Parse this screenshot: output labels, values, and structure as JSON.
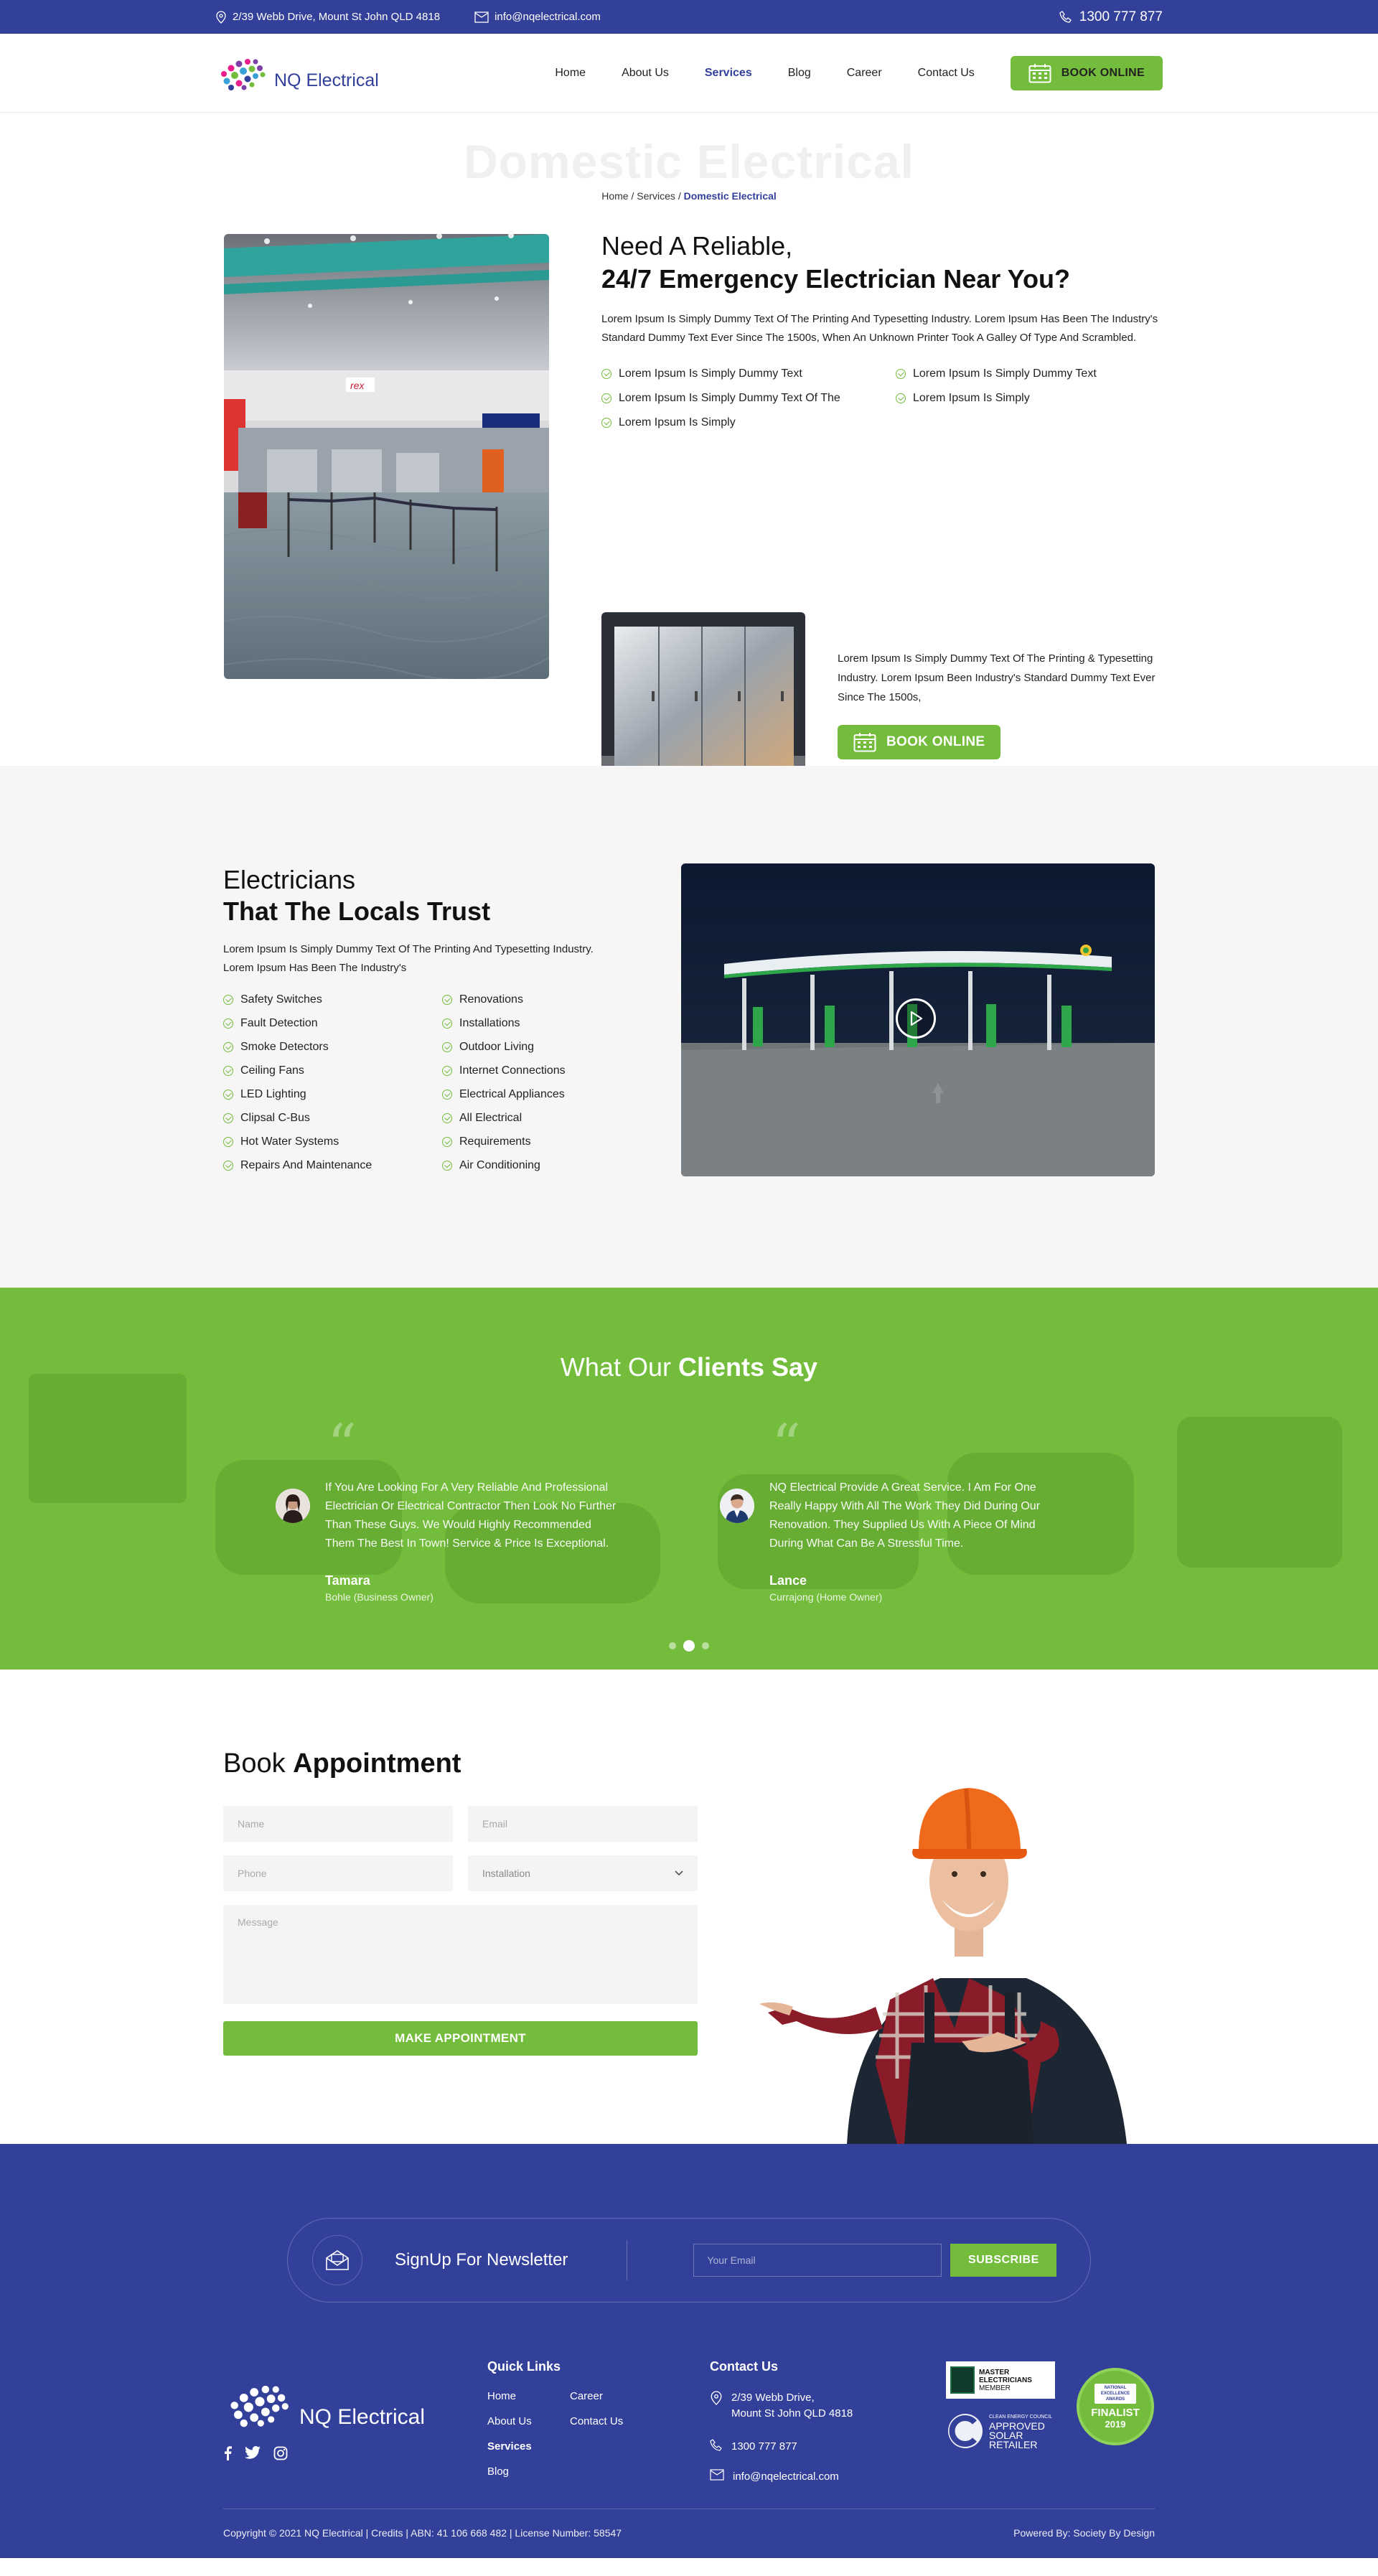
{
  "topbar": {
    "address": "2/39 Webb Drive,  Mount St John QLD 4818",
    "email": "info@nqelectrical.com",
    "phone": "1300 777 877"
  },
  "header": {
    "logo_text": "NQ Electrical",
    "nav": [
      "Home",
      "About Us",
      "Services",
      "Blog",
      "Career",
      "Contact Us"
    ],
    "active_nav": "Services",
    "book_label": "BOOK ONLINE"
  },
  "page_title": {
    "title": "Domestic Electrical",
    "crumb_home": "Home",
    "crumb_sep1": " / ",
    "crumb_services": "Services",
    "crumb_sep2": " / ",
    "crumb_current": "Domestic Electrical"
  },
  "intro": {
    "heading_light": "Need A Reliable,",
    "heading_bold": "24/7 Emergency Electrician Near You?",
    "paragraph": "Lorem Ipsum Is Simply Dummy Text Of The Printing And Typesetting Industry. Lorem Ipsum Has Been The Industry's Standard Dummy Text Ever Since The 1500s, When An Unknown Printer Took A Galley Of Type And Scrambled.",
    "checks": [
      "Lorem Ipsum Is Simply Dummy Text",
      "Lorem Ipsum Is Simply Dummy Text",
      "Lorem Ipsum Is Simply Dummy Text Of The",
      "Lorem Ipsum Is Simply",
      "Lorem Ipsum Is Simply"
    ],
    "paragraph2": "Lorem Ipsum Is Simply Dummy Text Of The Printing & Typesetting Industry. Lorem Ipsum Been Industry's Standard Dummy Text Ever Since The 1500s,",
    "book_label": "BOOK ONLINE"
  },
  "electricians": {
    "heading_light": "Electricians",
    "heading_bold": "That The Locals Trust",
    "paragraph": "Lorem Ipsum Is Simply Dummy Text Of The Printing And Typesetting Industry. Lorem Ipsum Has Been The Industry's",
    "services": [
      "Safety Switches",
      "Renovations",
      "Fault Detection",
      "Installations",
      "Smoke Detectors",
      "Outdoor Living",
      "Ceiling Fans",
      "Internet Connections",
      "LED Lighting",
      "Electrical Appliances",
      "Clipsal C-Bus",
      "All Electrical",
      "Hot Water Systems",
      "Requirements",
      "Repairs And Maintenance",
      "Air Conditioning"
    ]
  },
  "testimonials": {
    "heading_light": "What Our ",
    "heading_bold": "Clients Say",
    "items": [
      {
        "quote": "If You Are Looking For A Very Reliable And Professional Electrician Or Electrical Contractor Then Look No Further Than These Guys. We Would Highly Recommended Them The Best In Town! Service & Price Is Exceptional.",
        "name": "Tamara",
        "role": "Bohle (Business Owner)"
      },
      {
        "quote": "NQ Electrical Provide A Great Service. I Am For One Really Happy With All The Work They Did During Our Renovation. They Supplied Us With A Piece Of Mind During What Can Be A Stressful Time.",
        "name": "Lance",
        "role": "Currajong (Home Owner)"
      }
    ],
    "active_slide": 2,
    "slide_count": 3
  },
  "appointment": {
    "heading_light": "Book ",
    "heading_bold": "Appointment",
    "name_placeholder": "Name",
    "email_placeholder": "Email",
    "phone_placeholder": "Phone",
    "service_selected": "Installation",
    "message_placeholder": "Message",
    "submit_label": "MAKE APPOINTMENT"
  },
  "newsletter": {
    "title": "SignUp For Newsletter",
    "input_placeholder": "Your Email",
    "button_label": "SUBSCRIBE"
  },
  "footer": {
    "logo_text": "NQ Electrical",
    "quick_links_title": "Quick Links",
    "quick_links": [
      "Home",
      "Career",
      "About Us",
      "Contact Us",
      "Services",
      "",
      "Blog",
      ""
    ],
    "active_link": "Services",
    "contact_title": "Contact Us",
    "address_line1": "2/39 Webb Drive,",
    "address_line2": "Mount St John QLD 4818",
    "phone": "1300 777 877",
    "email": "info@nqelectrical.com",
    "badges": {
      "master_line1": "MASTER",
      "master_line2": "ELECTRICIANS",
      "master_line3": "MEMBER",
      "solar_top": "CLEAN ENERGY COUNCIL",
      "solar_line1": "APPROVED",
      "solar_line2": "SOLAR",
      "solar_line3": "RETAILER",
      "finalist_top": "NATIONAL",
      "finalist_mid": "EXCELLENCE AWARDS",
      "finalist_label": "FINALIST",
      "finalist_year": "2019"
    },
    "copyright": "Copyright © 2021 NQ Electrical | Credits  |  ABN: 41 106 668 482  |  License Number: 58547",
    "powered": "Powered By: Society By Design"
  },
  "colors": {
    "brand_blue": "#33409a",
    "brand_green": "#74bc3b"
  }
}
